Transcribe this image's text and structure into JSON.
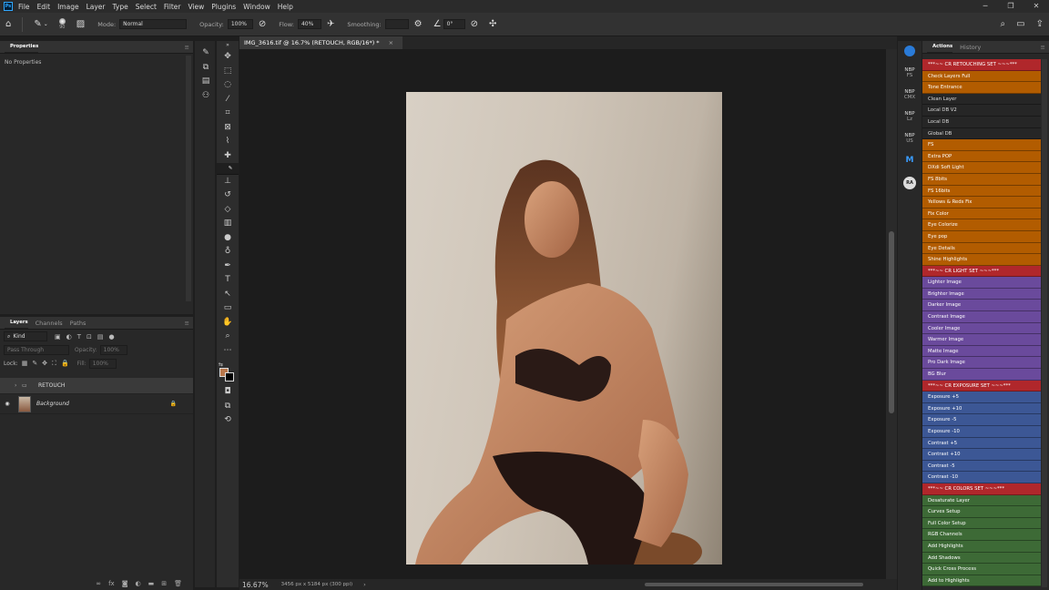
{
  "menu": {
    "app_icon": "Ps",
    "items": [
      "File",
      "Edit",
      "Image",
      "Layer",
      "Type",
      "Select",
      "Filter",
      "View",
      "Plugins",
      "Window",
      "Help"
    ]
  },
  "options": {
    "brush_size": "90",
    "mode_label": "Mode:",
    "mode_value": "Normal",
    "opacity_label": "Opacity:",
    "opacity_value": "100%",
    "flow_label": "Flow:",
    "flow_value": "40%",
    "smoothing_label": "Smoothing:",
    "smoothing_value": "",
    "angle_value": "0°"
  },
  "properties": {
    "tab": "Properties",
    "empty_text": "No Properties"
  },
  "layers": {
    "tabs": [
      "Layers",
      "Channels",
      "Paths"
    ],
    "filter_kind": "Kind",
    "blend_mode": "Pass Through",
    "opacity_label": "Opacity:",
    "opacity_value": "100%",
    "lock_label": "Lock:",
    "fill_label": "Fill:",
    "fill_value": "100%",
    "items": [
      {
        "name": "RETOUCH",
        "type": "group"
      },
      {
        "name": "Background",
        "type": "image"
      }
    ],
    "footer_icons": [
      "link-icon",
      "fx-icon",
      "mask-icon",
      "adjustment-icon",
      "folder-icon",
      "new-layer-icon",
      "trash-icon"
    ]
  },
  "document": {
    "tab_title": "IMG_3616.tif @ 16.7% (RETOUCH, RGB/16*) *",
    "zoom": "16.67%",
    "info": "3456 px x 5184 px (300 ppi)"
  },
  "plugins": [
    {
      "label": "",
      "icon": "c-logo-icon"
    },
    {
      "label": "NBP\nFS"
    },
    {
      "label": "NBP\nCMX"
    },
    {
      "label": "NBP\nLz"
    },
    {
      "label": "NBP\nUS"
    },
    {
      "label": "M"
    },
    {
      "label": "RA"
    }
  ],
  "actions_panel": {
    "tabs": [
      "Actions",
      "History"
    ],
    "items": [
      {
        "label": "***~~ CR RETOUCHING SET ~~~***",
        "color": "hdr"
      },
      {
        "label": "Check Layers Full",
        "color": "orange"
      },
      {
        "label": "Tone Entrance",
        "color": "orange"
      },
      {
        "label": "Clean Layer",
        "color": "none"
      },
      {
        "label": "Local DB V2",
        "color": "none"
      },
      {
        "label": "Local DB",
        "color": "none"
      },
      {
        "label": "Global DB",
        "color": "none"
      },
      {
        "label": "FS",
        "color": "orange"
      },
      {
        "label": "Extra POP",
        "color": "orange"
      },
      {
        "label": "DXdi Soft Light",
        "color": "orange"
      },
      {
        "label": "FS 8bits",
        "color": "orange"
      },
      {
        "label": "FS 16bits",
        "color": "orange"
      },
      {
        "label": "Yellows & Reds Fix",
        "color": "orange"
      },
      {
        "label": "Fix Color",
        "color": "orange"
      },
      {
        "label": "Eye Colorize",
        "color": "orange"
      },
      {
        "label": "Eye pop",
        "color": "orange"
      },
      {
        "label": "Eye Details",
        "color": "orange"
      },
      {
        "label": "Shine Highlights",
        "color": "orange"
      },
      {
        "label": "***~~ CR LIGHT SET ~~~***",
        "color": "hdr"
      },
      {
        "label": "Lighter Image",
        "color": "purple"
      },
      {
        "label": "Brighter Image",
        "color": "purple"
      },
      {
        "label": "Darker Image",
        "color": "purple"
      },
      {
        "label": "Contrast Image",
        "color": "purple"
      },
      {
        "label": "Cooler Image",
        "color": "purple"
      },
      {
        "label": "Warmer Image",
        "color": "purple"
      },
      {
        "label": "Matte Image",
        "color": "purple"
      },
      {
        "label": "Pro Dark Image",
        "color": "purple"
      },
      {
        "label": "BG Blur",
        "color": "purple"
      },
      {
        "label": "***~~ CR EXPOSURE SET ~~~***",
        "color": "hdr"
      },
      {
        "label": "Exposure +5",
        "color": "blue"
      },
      {
        "label": "Exposure +10",
        "color": "blue"
      },
      {
        "label": "Exposure -5",
        "color": "blue"
      },
      {
        "label": "Exposure -10",
        "color": "blue"
      },
      {
        "label": "Contrast +5",
        "color": "blue"
      },
      {
        "label": "Contrast +10",
        "color": "blue"
      },
      {
        "label": "Contrast -5",
        "color": "blue"
      },
      {
        "label": "Contrast -10",
        "color": "blue"
      },
      {
        "label": "***~~ CR COLORS SET ~~~***",
        "color": "hdr"
      },
      {
        "label": "Desaturate Layer",
        "color": "green"
      },
      {
        "label": "Curves Setup",
        "color": "green"
      },
      {
        "label": "Full Color Setup",
        "color": "green"
      },
      {
        "label": "RGB Channels",
        "color": "green"
      },
      {
        "label": "Add Highlights",
        "color": "green"
      },
      {
        "label": "Add Shadows",
        "color": "green"
      },
      {
        "label": "Quick Cross Process",
        "color": "green"
      },
      {
        "label": "Add to Highlights",
        "color": "green"
      }
    ]
  },
  "colors": {
    "foreground": "#b8774b",
    "background": "#000000",
    "accent": "#31a8ff"
  }
}
